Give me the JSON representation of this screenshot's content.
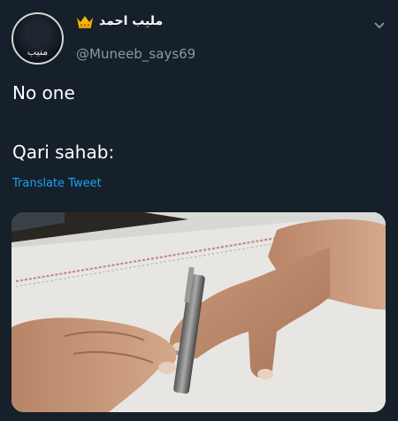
{
  "user": {
    "display_name": "مليب احمد",
    "handle": "@Muneeb_says69",
    "avatar_text": "منيب",
    "badge_icon": "crown-icon"
  },
  "tweet": {
    "line1": "No one",
    "line2": "Qari sahab:",
    "translate_label": "Translate Tweet"
  },
  "media": {
    "description_icon": "photo-hands-pen"
  },
  "colors": {
    "background": "#15202b",
    "link": "#1da1f2",
    "muted": "#8899a6",
    "crown": "#f5b700"
  }
}
